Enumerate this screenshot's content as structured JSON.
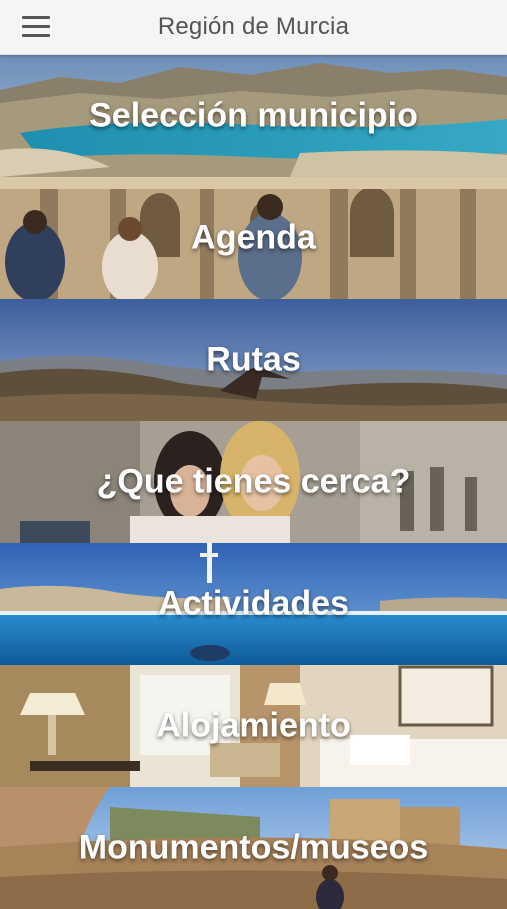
{
  "header": {
    "title": "Región de Murcia",
    "menu_icon": "hamburger-menu-icon"
  },
  "menu": {
    "items": [
      {
        "label": "Selección municipio"
      },
      {
        "label": "Agenda"
      },
      {
        "label": "Rutas"
      },
      {
        "label": "¿Que tienes cerca?"
      },
      {
        "label": "Actividades"
      },
      {
        "label": "Alojamiento"
      },
      {
        "label": "Monumentos/museos"
      }
    ]
  },
  "colors": {
    "appbar": "#f5f5f5",
    "title_text": "#555555",
    "tile_text": "#ffffff"
  }
}
